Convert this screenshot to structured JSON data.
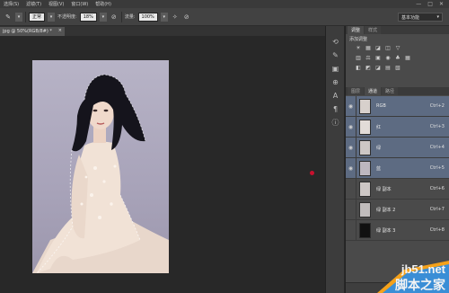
{
  "menubar": {
    "items": [
      "选择(S)",
      "滤镜(T)",
      "视图(V)",
      "窗口(W)",
      "帮助(H)"
    ],
    "window_controls": [
      "—",
      "□",
      "✕"
    ]
  },
  "options": {
    "mode_label": "正常",
    "opacity_label": "不透明度:",
    "opacity_value": "18%",
    "flow_label": "流量:",
    "flow_value": "100%",
    "workspace": "基本功能"
  },
  "document": {
    "tab_label": "jpg @ 50%(RGB/8#) *",
    "close": "×"
  },
  "adjustments": {
    "tabs": [
      "调整",
      "样式"
    ],
    "title": "添加调整",
    "row1_icons": [
      "☀",
      "▦",
      "◪",
      "◫",
      "▽"
    ],
    "row2_icons": [
      "▥",
      "⚖",
      "▣",
      "◉",
      "♣",
      "▦"
    ],
    "row3_icons": [
      "◧",
      "◩",
      "◪",
      "▤",
      "▧"
    ]
  },
  "channels_panel": {
    "tabs": [
      "图层",
      "通道",
      "路径"
    ],
    "channels": [
      {
        "name": "RGB",
        "shortcut": "Ctrl+2",
        "selected": true,
        "thumb": "#d7d0cc"
      },
      {
        "name": "红",
        "shortcut": "Ctrl+3",
        "selected": true,
        "thumb": "#e2dcd8"
      },
      {
        "name": "绿",
        "shortcut": "Ctrl+4",
        "selected": true,
        "thumb": "#cdc7c5"
      },
      {
        "name": "蓝",
        "shortcut": "Ctrl+5",
        "selected": true,
        "thumb": "#bdb7bf"
      },
      {
        "name": "绿 副本",
        "shortcut": "Ctrl+6",
        "selected": false,
        "thumb": "#cdc7c5"
      },
      {
        "name": "绿 副本 2",
        "shortcut": "Ctrl+7",
        "selected": false,
        "thumb": "#c0bcbc"
      },
      {
        "name": "绿 副本 3",
        "shortcut": "Ctrl+8",
        "selected": false,
        "thumb": "#111111"
      }
    ],
    "footer_icons": [
      "◌",
      "▣",
      "⊡",
      "🗑"
    ]
  },
  "watermark": {
    "domain": "jb51.net",
    "name": "脚本之家"
  },
  "colors": {
    "selection": "#5d6b82",
    "panel": "#4a4a4a",
    "canvas": "#282828"
  }
}
